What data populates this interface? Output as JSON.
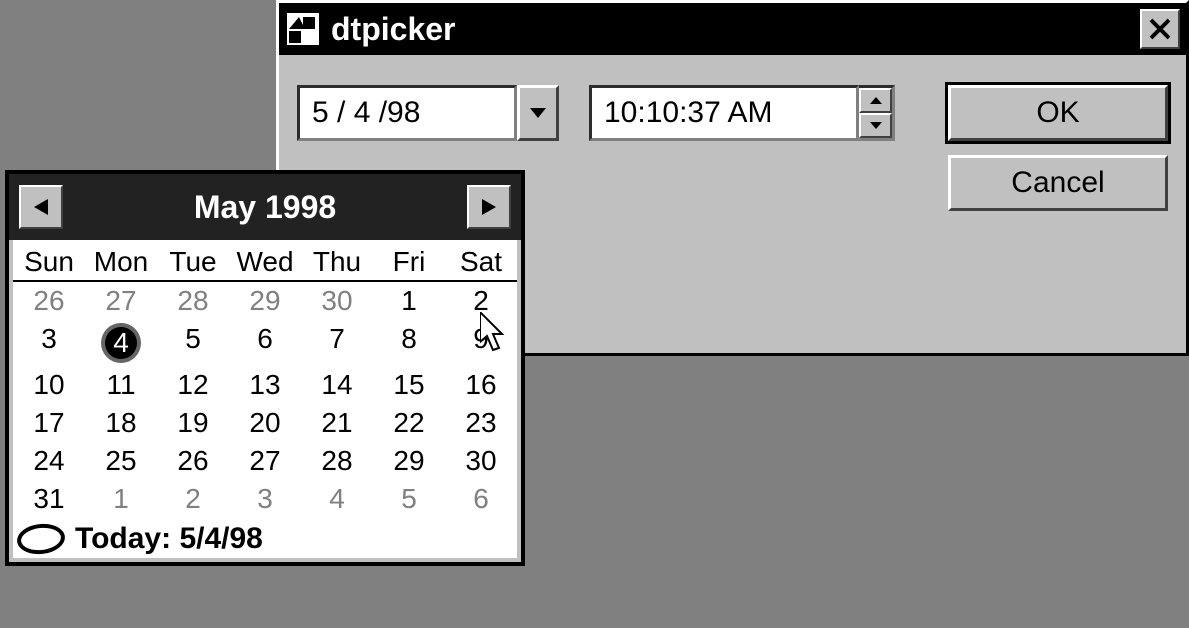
{
  "dialog": {
    "title": "dtpicker",
    "date_value": "5 / 4 /98",
    "time_value": "10:10:37 AM",
    "ok_label": "OK",
    "cancel_label": "Cancel"
  },
  "calendar": {
    "month_title": "May 1998",
    "day_headers": [
      "Sun",
      "Mon",
      "Tue",
      "Wed",
      "Thu",
      "Fri",
      "Sat"
    ],
    "weeks": [
      [
        {
          "d": "26",
          "other": true
        },
        {
          "d": "27",
          "other": true
        },
        {
          "d": "28",
          "other": true
        },
        {
          "d": "29",
          "other": true
        },
        {
          "d": "30",
          "other": true
        },
        {
          "d": "1"
        },
        {
          "d": "2"
        }
      ],
      [
        {
          "d": "3"
        },
        {
          "d": "4",
          "selected": true
        },
        {
          "d": "5"
        },
        {
          "d": "6"
        },
        {
          "d": "7"
        },
        {
          "d": "8"
        },
        {
          "d": "9"
        }
      ],
      [
        {
          "d": "10"
        },
        {
          "d": "11"
        },
        {
          "d": "12"
        },
        {
          "d": "13"
        },
        {
          "d": "14"
        },
        {
          "d": "15"
        },
        {
          "d": "16"
        }
      ],
      [
        {
          "d": "17"
        },
        {
          "d": "18"
        },
        {
          "d": "19"
        },
        {
          "d": "20"
        },
        {
          "d": "21"
        },
        {
          "d": "22"
        },
        {
          "d": "23"
        }
      ],
      [
        {
          "d": "24"
        },
        {
          "d": "25"
        },
        {
          "d": "26"
        },
        {
          "d": "27"
        },
        {
          "d": "28"
        },
        {
          "d": "29"
        },
        {
          "d": "30"
        }
      ],
      [
        {
          "d": "31"
        },
        {
          "d": "1",
          "other": true
        },
        {
          "d": "2",
          "other": true
        },
        {
          "d": "3",
          "other": true
        },
        {
          "d": "4",
          "other": true
        },
        {
          "d": "5",
          "other": true
        },
        {
          "d": "6",
          "other": true
        }
      ]
    ],
    "today_label": "Today: 5/4/98"
  }
}
